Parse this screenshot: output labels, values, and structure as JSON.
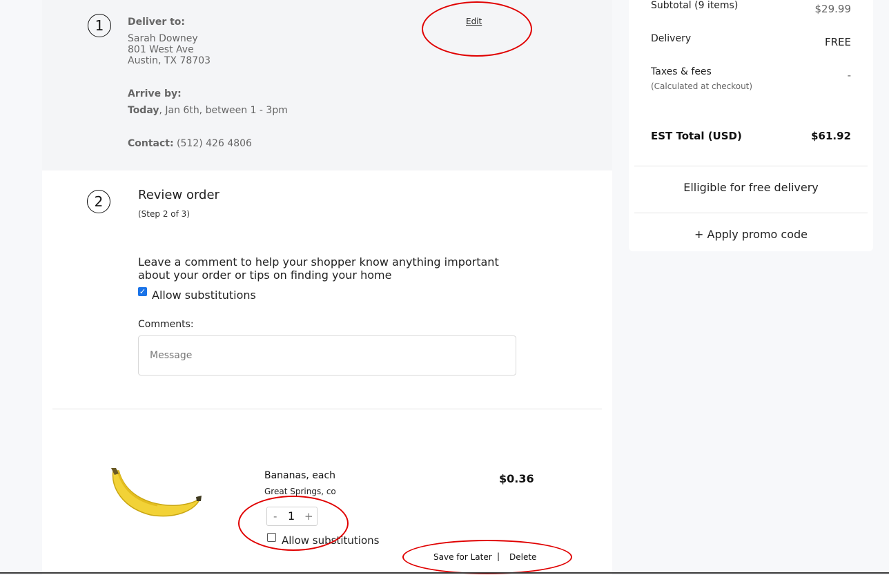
{
  "delivery": {
    "step": "1",
    "deliver_to_label": "Deliver to:",
    "name": "Sarah Downey",
    "address1": "801 West Ave",
    "address2": "Austin, TX 78703",
    "arrive_label": "Arrive by:",
    "arrive_day": "Today",
    "arrive_rest": ", Jan 6th, between 1 - 3pm",
    "contact_label": "Contact:",
    "contact_value": "(512) 426 4806",
    "edit_label": "Edit"
  },
  "review": {
    "step": "2",
    "title": "Review order",
    "subtitle": "(Step 2 of 3)",
    "comment_prompt_line1": "Leave a comment to help your shopper know anything important",
    "comment_prompt_line2": "about your order or tips on finding your home",
    "allow_substitutions_label": "Allow substitutions",
    "allow_substitutions_checked": true,
    "comments_label": "Comments:",
    "message_placeholder": "Message"
  },
  "item": {
    "name": "Bananas, each",
    "brand": "Great Springs, co",
    "price": "$0.36",
    "quantity": "1",
    "minus": "-",
    "plus": "+",
    "allow_substitutions_label": "Allow substitutions",
    "allow_substitutions_checked": false,
    "save_for_later": "Save for Later",
    "separator": "|",
    "delete": "Delete"
  },
  "summary": {
    "subtotal_label": "Subtotal (9 items)",
    "subtotal_value": "$29.99",
    "delivery_label": "Delivery",
    "delivery_value": "FREE",
    "taxes_label": "Taxes & fees",
    "taxes_note": "(Calculated at checkout)",
    "taxes_value": "-",
    "total_label": "EST Total (USD)",
    "total_value": "$61.92",
    "free_delivery": "Elligible for free delivery",
    "promo": "+ Apply promo code"
  },
  "colors": {
    "annotation": "#e00000",
    "checkbox": "#1a73e8"
  }
}
